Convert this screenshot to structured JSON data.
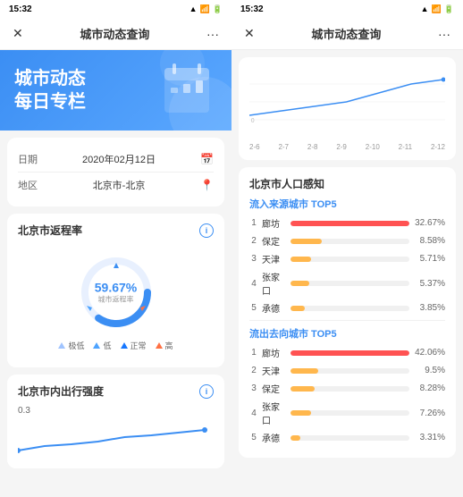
{
  "left": {
    "status_time": "15:32",
    "nav_title": "城市动态查询",
    "hero_line1": "城市动态",
    "hero_line2": "每日专栏",
    "date_label": "日期",
    "date_value": "2020年02月12日",
    "region_label": "地区",
    "region_value": "北京市-北京",
    "return_rate_title": "北京市返程率",
    "return_rate_pct": "59.67%",
    "return_rate_sublabel": "城市返程率",
    "legend": [
      {
        "label": "极低",
        "color": "#a0c4ff"
      },
      {
        "label": "低",
        "color": "#4da3ff"
      },
      {
        "label": "正常",
        "color": "#1677ff"
      },
      {
        "label": "高",
        "color": "#ff7043"
      }
    ],
    "mobility_title": "北京市内出行强度",
    "mobility_value": "0.3"
  },
  "right": {
    "status_time": "15:32",
    "nav_title": "城市动态查询",
    "x_axis": [
      "2-6",
      "2-7",
      "2-8",
      "2-9",
      "2-10",
      "2-11",
      "2-12"
    ],
    "y_axis_start": "0",
    "pop_title": "北京市人口感知",
    "inflow_title": "流入来源城市 TOP5",
    "inflow": [
      {
        "rank": "1",
        "name": "廊坊",
        "pct": "32.67%",
        "ratio": 1.0,
        "color": "#ff5252"
      },
      {
        "rank": "2",
        "name": "保定",
        "pct": "8.58%",
        "ratio": 0.26,
        "color": "#ffb74d"
      },
      {
        "rank": "3",
        "name": "天津",
        "pct": "5.71%",
        "ratio": 0.17,
        "color": "#ffb74d"
      },
      {
        "rank": "4",
        "name": "张家口",
        "pct": "5.37%",
        "ratio": 0.16,
        "color": "#ffb74d"
      },
      {
        "rank": "5",
        "name": "承德",
        "pct": "3.85%",
        "ratio": 0.12,
        "color": "#ffb74d"
      }
    ],
    "outflow_title": "流出去向城市 TOP5",
    "outflow": [
      {
        "rank": "1",
        "name": "廊坊",
        "pct": "42.06%",
        "ratio": 1.0,
        "color": "#ff5252"
      },
      {
        "rank": "2",
        "name": "天津",
        "pct": "9.5%",
        "ratio": 0.23,
        "color": "#ffb74d"
      },
      {
        "rank": "3",
        "name": "保定",
        "pct": "8.28%",
        "ratio": 0.2,
        "color": "#ffb74d"
      },
      {
        "rank": "4",
        "name": "张家口",
        "pct": "7.26%",
        "ratio": 0.17,
        "color": "#ffb74d"
      },
      {
        "rank": "5",
        "name": "承德",
        "pct": "3.31%",
        "ratio": 0.08,
        "color": "#ffb74d"
      }
    ]
  }
}
